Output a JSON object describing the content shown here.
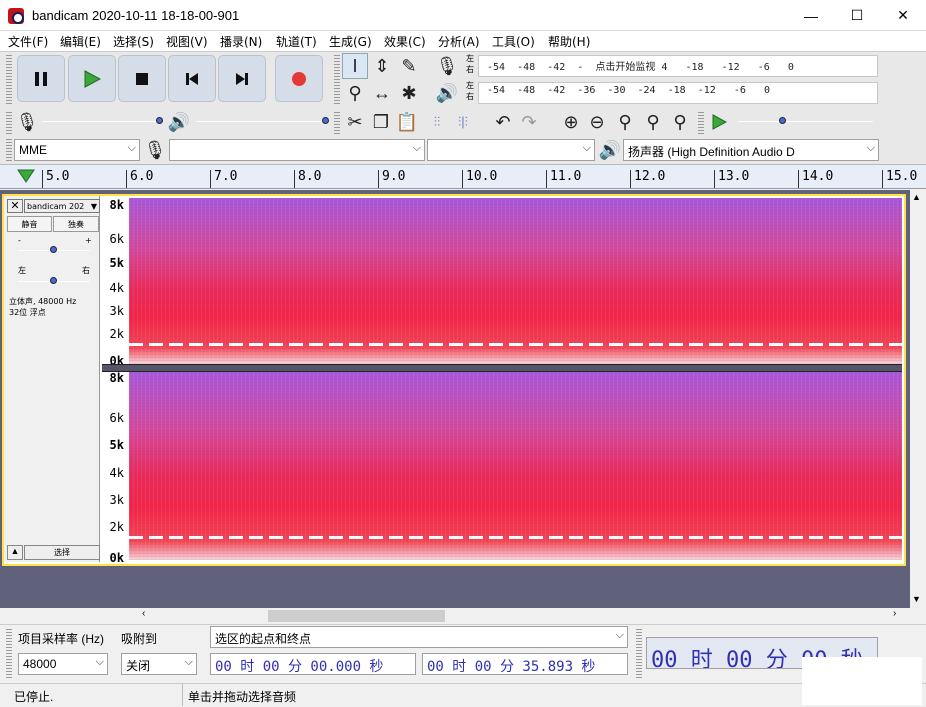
{
  "window": {
    "title": "bandicam 2020-10-11 18-18-00-901",
    "minimize": "—",
    "maximize": "☐",
    "close": "✕"
  },
  "menu": [
    {
      "label": "文件(F)"
    },
    {
      "label": "编辑(E)"
    },
    {
      "label": "选择(S)"
    },
    {
      "label": "视图(V)"
    },
    {
      "label": "播录(N)"
    },
    {
      "label": "轨道(T)"
    },
    {
      "label": "生成(G)"
    },
    {
      "label": "效果(C)"
    },
    {
      "label": "分析(A)"
    },
    {
      "label": "工具(O)"
    },
    {
      "label": "帮助(H)"
    }
  ],
  "transport": {
    "pause_icon": "pause-icon",
    "play_icon": "play-icon",
    "stop_icon": "stop-icon",
    "skip_start_icon": "skip-start-icon",
    "skip_end_icon": "skip-end-icon",
    "record_icon": "record-icon"
  },
  "meters": {
    "record_lr_top": "左",
    "record_lr_bottom": "右",
    "record_scale": "-54  -48  -42  -  点击开始监视 4   -18   -12   -6   0",
    "play_lr_top": "左",
    "play_lr_bottom": "右",
    "play_scale": "-54  -48  -42  -36  -30  -24  -18  -12   -6   0"
  },
  "device": {
    "host": "MME",
    "record_device": "",
    "record_channels": "",
    "playback_device": "扬声器 (High Definition Audio D"
  },
  "ruler": {
    "ticks": [
      "5.0",
      "6.0",
      "7.0",
      "8.0",
      "9.0",
      "10.0",
      "11.0",
      "12.0",
      "13.0",
      "14.0",
      "15.0"
    ]
  },
  "track": {
    "name": "bandicam 202",
    "mute": "静音",
    "solo": "独奏",
    "gain_minus": "-",
    "gain_plus": "+",
    "pan_left": "左",
    "pan_right": "右",
    "info_line1": "立体声, 48000 Hz",
    "info_line2": "32位 浮点",
    "select": "选择",
    "gain_level": 0.5,
    "pan_level": 0.5,
    "y_labels": [
      "8k",
      "6k",
      "5k",
      "4k",
      "3k",
      "2k",
      "0k"
    ]
  },
  "selection": {
    "rate_label": "项目采样率 (Hz)",
    "rate_value": "48000",
    "snap_label": "吸附到",
    "snap_value": "关闭",
    "mode_label": "选区的起点和终点",
    "start_time": "00 时 00 分 00.000 秒",
    "end_time": "00 时 00 分 35.893 秒",
    "audio_pos": "00 时 00 分 00 秒"
  },
  "status": {
    "left": "已停止.",
    "right": "单击并拖动选择音频"
  },
  "colors": {
    "accent": "#4a6ad0",
    "track_border": "#ffe24a",
    "spectrogram_hot": "#f52442",
    "spectrogram_cool": "#a958d8",
    "play_green": "#3ca83c",
    "record_red": "#e53935"
  }
}
